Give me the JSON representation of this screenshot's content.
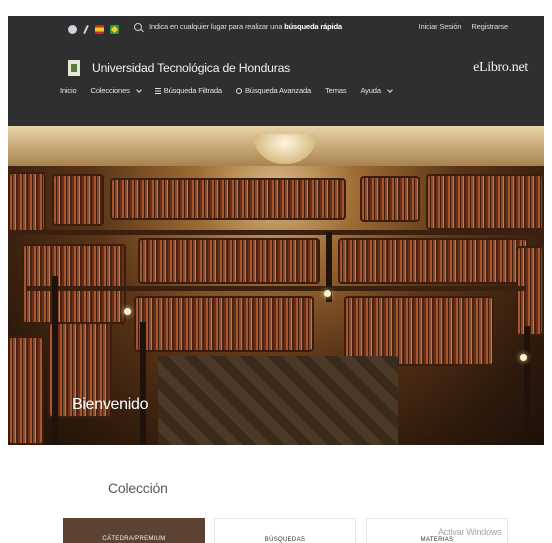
{
  "header": {
    "lang_icons": [
      "globe-icon",
      "pen-icon",
      "spain-flag-icon",
      "brazil-flag-icon"
    ],
    "search_prompt_prefix": "Indica en cualquier lugar para realizar una ",
    "search_prompt_bold": "búsqueda rápida",
    "login_label": "Iniciar Sesión",
    "register_label": "Registrarse",
    "university_name": "Universidad Tecnológica de Honduras",
    "brand": "eLibro.net"
  },
  "nav": {
    "home": "Inicio",
    "collections": "Colecciones",
    "filtered_search": "Búsqueda Filtrada",
    "advanced_search": "Búsqueda Avanzada",
    "topics": "Temas",
    "help": "Ayuda"
  },
  "hero": {
    "welcome": "Bienvenido"
  },
  "collection": {
    "title": "Colección",
    "cards": [
      "CÁTEDRA/PREMIUM",
      "BÚSQUEDAS",
      "MATERIAS"
    ]
  },
  "system": {
    "watermark": "Activar Windows"
  },
  "colors": {
    "header_bg": "#2f2f31",
    "page_bg": "#ffffff"
  }
}
